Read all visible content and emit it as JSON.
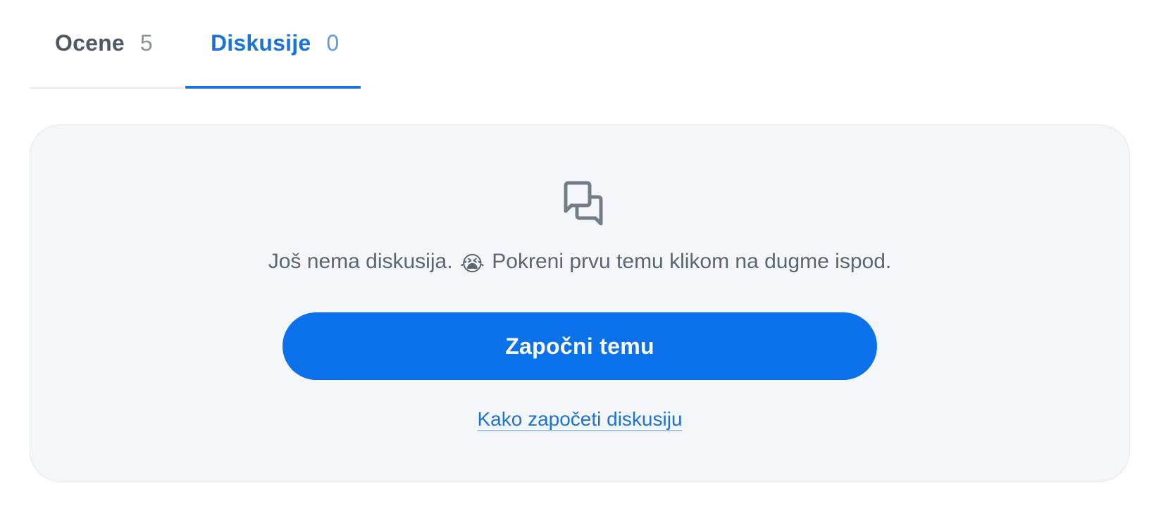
{
  "tabs": [
    {
      "label": "Ocene",
      "count": "5",
      "active": false
    },
    {
      "label": "Diskusije",
      "count": "0",
      "active": true
    }
  ],
  "empty_state": {
    "icon": "chat-bubbles-icon",
    "message_before": "Još nema diskusija.",
    "emoji": "😭",
    "message_after": "Pokreni prvu temu klikom na dugme ispod.",
    "button_label": "Započni temu",
    "help_link": "Kako započeti diskusiju"
  },
  "colors": {
    "accent": "#0a71eb",
    "active_tab": "#1a73d9",
    "card_background": "#f4f6fa",
    "muted_text": "#5a6670"
  }
}
